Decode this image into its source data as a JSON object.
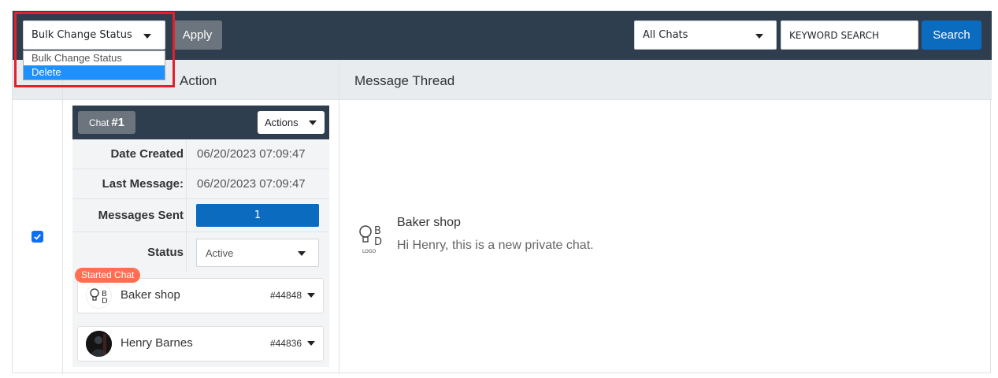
{
  "toolbar": {
    "bulk_select_value": "Bulk Change Status",
    "apply_label": "Apply",
    "chats_filter_value": "All Chats",
    "keyword_placeholder": "KEYWORD SEARCH",
    "search_label": "Search"
  },
  "bulk_dropdown": {
    "options": [
      "Bulk Change Status",
      "Delete"
    ],
    "highlighted": "Delete"
  },
  "table": {
    "headers": {
      "action": "Action",
      "thread": "Message Thread"
    },
    "row_checked": true
  },
  "chat_card": {
    "chat_label": "Chat",
    "chat_number": "#1",
    "actions_label": "Actions",
    "date_created_label": "Date Created",
    "date_created_value": "06/20/2023 07:09:47",
    "last_message_label": "Last Message:",
    "last_message_value": "06/20/2023 07:09:47",
    "messages_sent_label": "Messages Sent",
    "messages_sent_value": "1",
    "status_label": "Status",
    "status_value": "Active",
    "started_badge": "Started Chat",
    "participants": [
      {
        "name": "Baker shop",
        "id": "#44848",
        "avatar": "bd-logo-icon"
      },
      {
        "name": "Henry Barnes",
        "id": "#44836",
        "avatar": "user-photo"
      }
    ]
  },
  "thread": {
    "sender": "Baker shop",
    "message": "Hi Henry, this is a new private chat.",
    "logo_text": "LOGO"
  }
}
